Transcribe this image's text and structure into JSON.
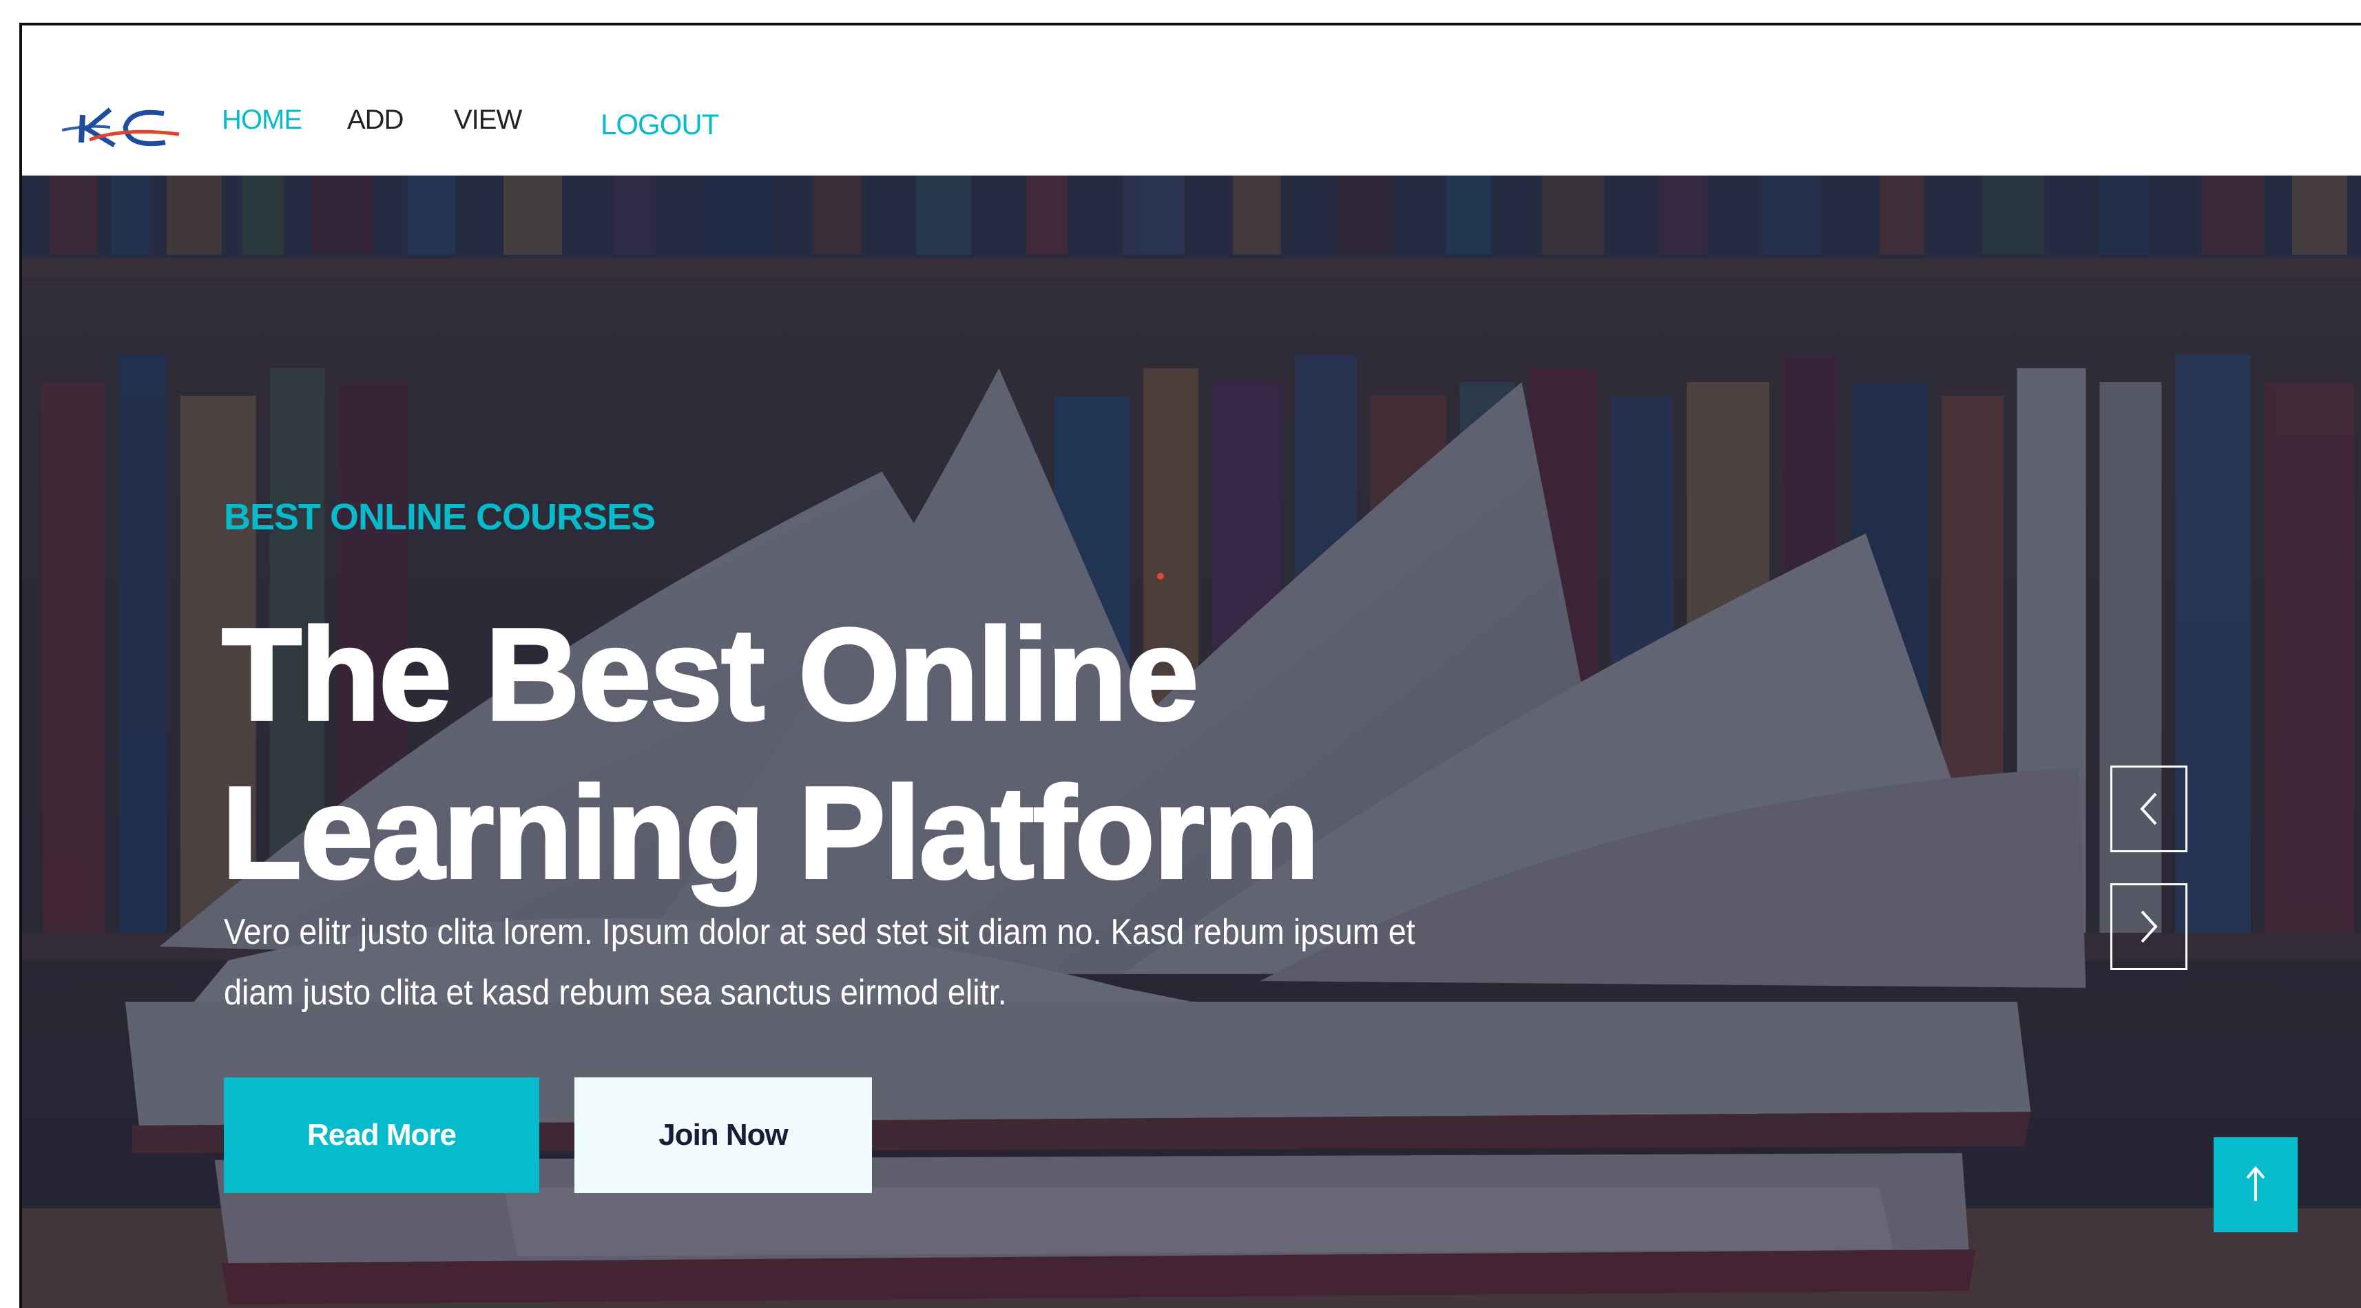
{
  "navbar": {
    "brand_logo": "KC",
    "links": [
      {
        "label": "HOME",
        "active": true
      },
      {
        "label": "ADD",
        "active": false
      },
      {
        "label": "VIEW",
        "active": false
      },
      {
        "label": "LOGOUT",
        "active": true
      }
    ]
  },
  "hero": {
    "eyebrow": "BEST ONLINE COURSES",
    "headline_line1": "The Best Online",
    "headline_line2": "Learning Platform",
    "lead": "Vero elitr justo clita lorem. Ipsum dolor at sed stet sit diam no. Kasd rebum ipsum et diam justo clita et kasd rebum sea sanctus eirmod elitr.",
    "buttons": {
      "primary": "Read More",
      "secondary": "Join Now"
    },
    "carousel": {
      "prev_icon": "chevron-left-icon",
      "next_icon": "chevron-right-icon"
    }
  },
  "back_to_top_icon": "arrow-up-icon",
  "colors": {
    "accent": "#06BBCC",
    "dark": "#181D38",
    "nav_text": "#222222",
    "light_button": "#F0FBFC"
  }
}
